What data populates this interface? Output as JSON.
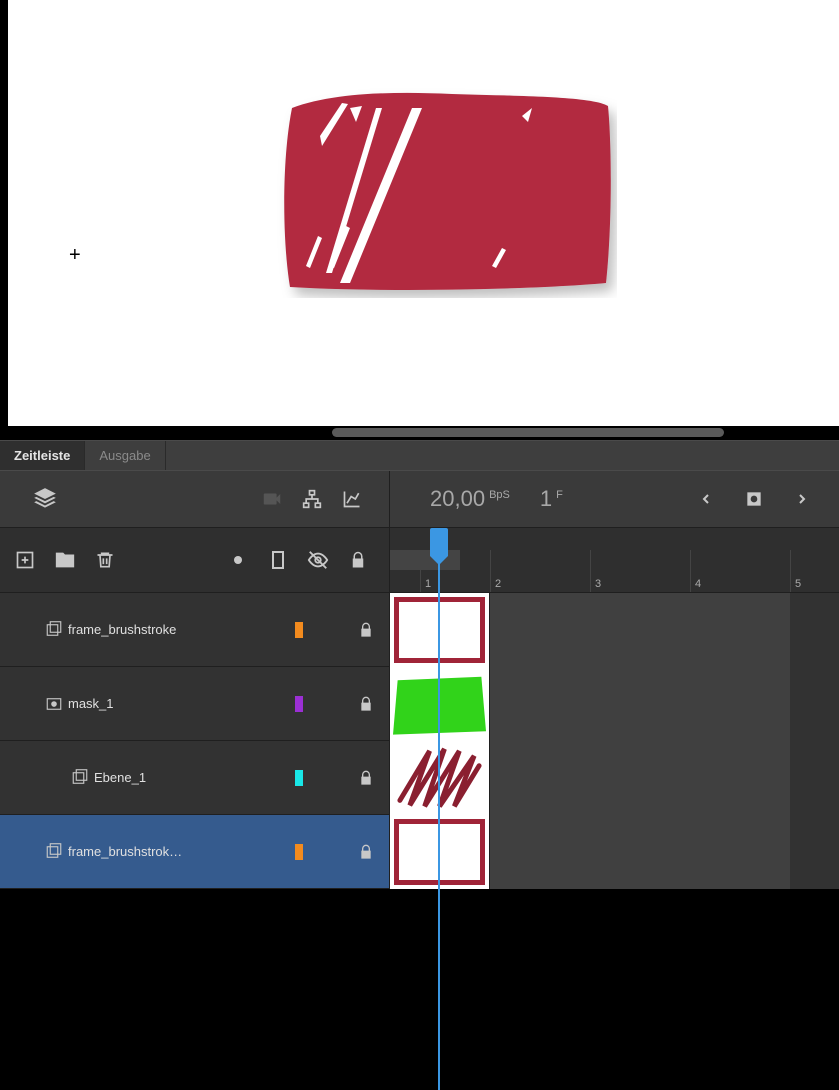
{
  "tabs": {
    "timeline": "Zeitleiste",
    "output": "Ausgabe"
  },
  "toolbar": {
    "fps_value": "20,00",
    "fps_suffix": "BpS",
    "frame_value": "1",
    "frame_suffix": "F"
  },
  "ruler": {
    "marks": [
      "1",
      "2",
      "3",
      "4",
      "5"
    ]
  },
  "layers": [
    {
      "name": "frame_brushstroke",
      "color": "#f38b1e",
      "indent": 0,
      "selected": false,
      "icon": "layer",
      "thumb": "frame"
    },
    {
      "name": "mask_1",
      "color": "#9b2fd4",
      "indent": 0,
      "selected": false,
      "icon": "mask",
      "thumb": "green"
    },
    {
      "name": "Ebene_1",
      "color": "#19e7e7",
      "indent": 1,
      "selected": false,
      "icon": "layer",
      "thumb": "scribble"
    },
    {
      "name": "frame_brushstrok…",
      "color": "#f38b1e",
      "indent": 0,
      "selected": true,
      "icon": "layer",
      "thumb": "frame"
    }
  ]
}
